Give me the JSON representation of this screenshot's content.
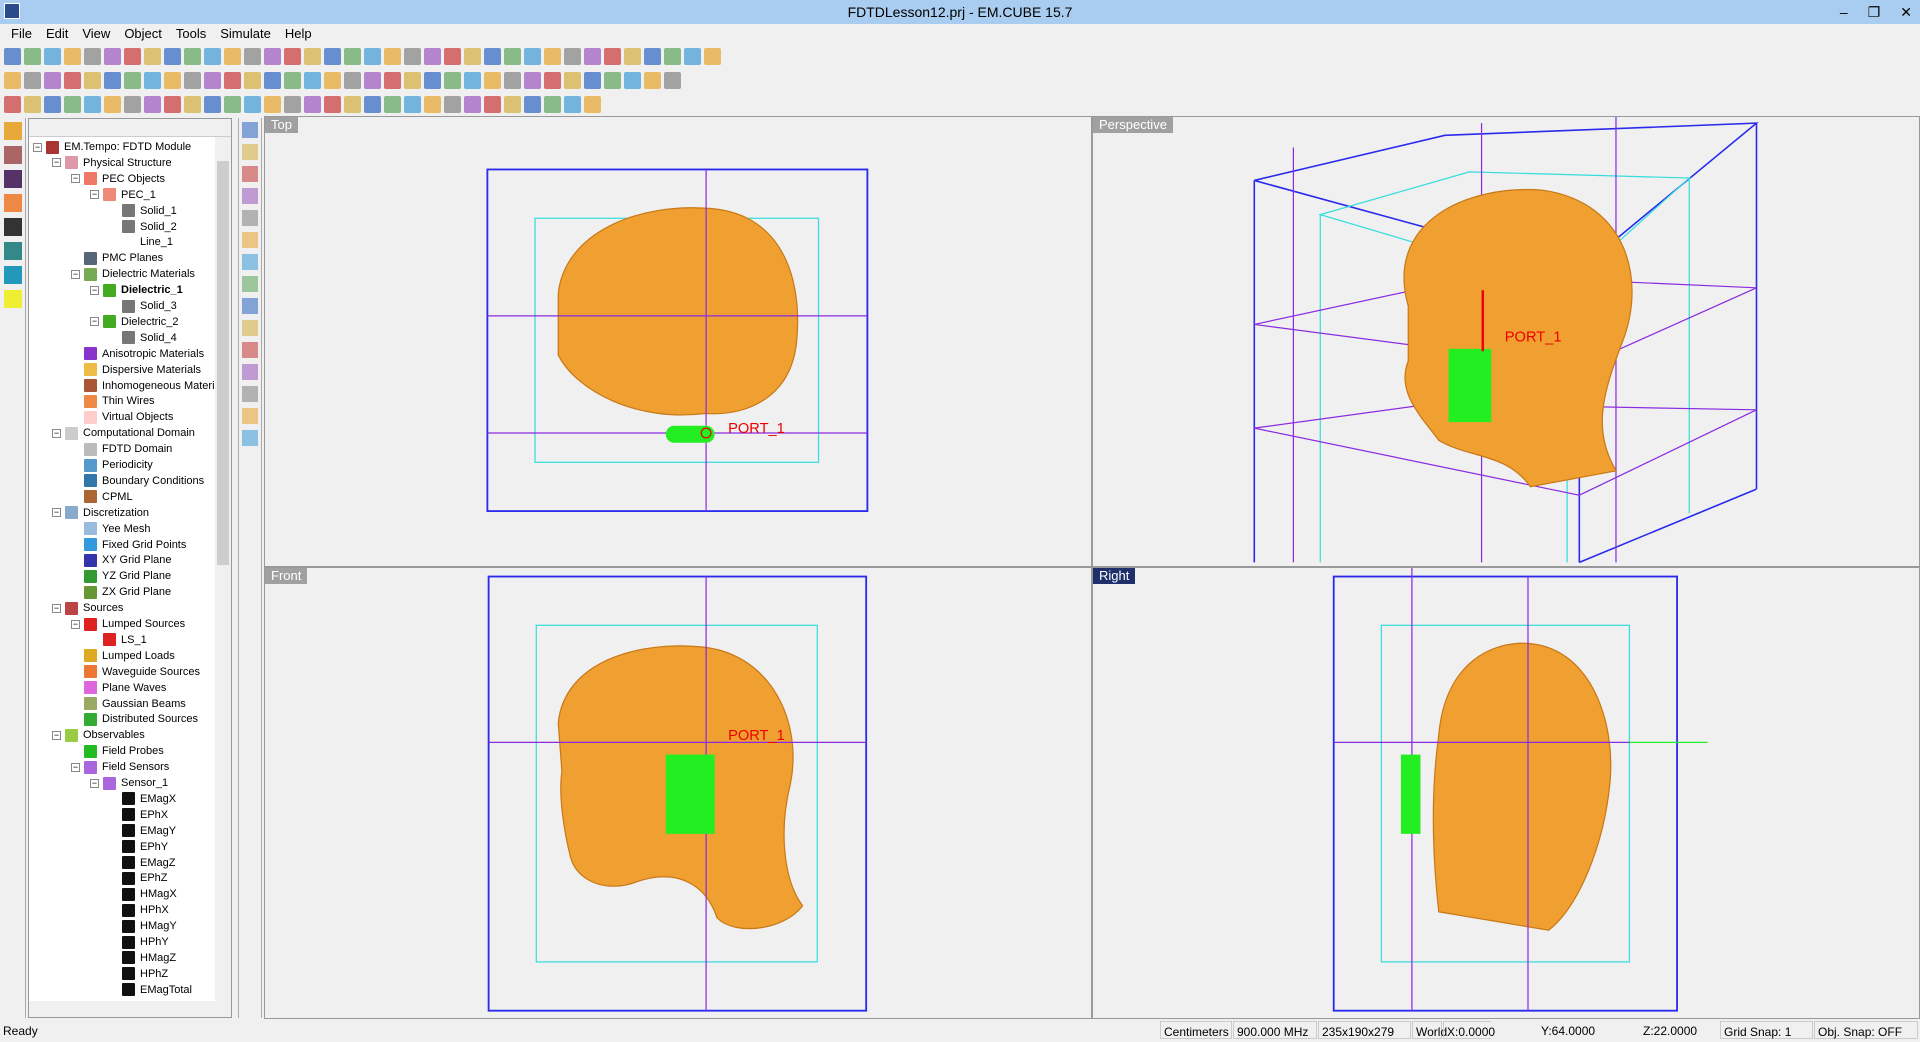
{
  "window": {
    "title": "FDTDLesson12.prj - EM.CUBE 15.7",
    "min": "–",
    "restore": "❐",
    "close": "✕"
  },
  "menu": [
    "File",
    "Edit",
    "View",
    "Object",
    "Tools",
    "Simulate",
    "Help"
  ],
  "toolbar_rows": [
    36,
    34,
    30
  ],
  "tree": {
    "items": [
      {
        "l": 0,
        "e": "−",
        "c": "#a33",
        "t": "EM.Tempo: FDTD Module"
      },
      {
        "l": 1,
        "e": "−",
        "c": "#d9a",
        "t": "Physical Structure"
      },
      {
        "l": 2,
        "e": "−",
        "c": "#e76",
        "t": "PEC Objects"
      },
      {
        "l": 3,
        "e": "−",
        "c": "#e87",
        "t": "PEC_1"
      },
      {
        "l": 4,
        "e": "",
        "c": "#777",
        "t": "Solid_1"
      },
      {
        "l": 4,
        "e": "",
        "c": "#777",
        "t": "Solid_2"
      },
      {
        "l": 4,
        "e": "",
        "c": "#fff",
        "t": "Line_1"
      },
      {
        "l": 2,
        "e": "",
        "c": "#567",
        "t": "PMC Planes"
      },
      {
        "l": 2,
        "e": "−",
        "c": "#7a5",
        "t": "Dielectric Materials"
      },
      {
        "l": 3,
        "e": "−",
        "c": "#4a2",
        "t": "Dielectric_1",
        "b": true
      },
      {
        "l": 4,
        "e": "",
        "c": "#777",
        "t": "Solid_3"
      },
      {
        "l": 3,
        "e": "−",
        "c": "#4a2",
        "t": "Dielectric_2"
      },
      {
        "l": 4,
        "e": "",
        "c": "#777",
        "t": "Solid_4"
      },
      {
        "l": 2,
        "e": "",
        "c": "#83c",
        "t": "Anisotropic Materials"
      },
      {
        "l": 2,
        "e": "",
        "c": "#eb4",
        "t": "Dispersive Materials"
      },
      {
        "l": 2,
        "e": "",
        "c": "#a53",
        "t": "Inhomogeneous Materi"
      },
      {
        "l": 2,
        "e": "",
        "c": "#e84",
        "t": "Thin Wires"
      },
      {
        "l": 2,
        "e": "",
        "c": "#fcc",
        "t": "Virtual Objects"
      },
      {
        "l": 1,
        "e": "−",
        "c": "#ccc",
        "t": "Computational Domain"
      },
      {
        "l": 2,
        "e": "",
        "c": "#bbb",
        "t": "FDTD Domain"
      },
      {
        "l": 2,
        "e": "",
        "c": "#59c",
        "t": "Periodicity"
      },
      {
        "l": 2,
        "e": "",
        "c": "#37a",
        "t": "Boundary Conditions"
      },
      {
        "l": 2,
        "e": "",
        "c": "#a63",
        "t": "CPML"
      },
      {
        "l": 1,
        "e": "−",
        "c": "#8ac",
        "t": "Discretization"
      },
      {
        "l": 2,
        "e": "",
        "c": "#9bd",
        "t": "Yee Mesh"
      },
      {
        "l": 2,
        "e": "",
        "c": "#39d",
        "t": "Fixed Grid Points"
      },
      {
        "l": 2,
        "e": "",
        "c": "#33a",
        "t": "XY Grid Plane"
      },
      {
        "l": 2,
        "e": "",
        "c": "#393",
        "t": "YZ Grid Plane"
      },
      {
        "l": 2,
        "e": "",
        "c": "#693",
        "t": "ZX Grid Plane"
      },
      {
        "l": 1,
        "e": "−",
        "c": "#b44",
        "t": "Sources"
      },
      {
        "l": 2,
        "e": "−",
        "c": "#d22",
        "t": "Lumped Sources"
      },
      {
        "l": 3,
        "e": "",
        "c": "#d22",
        "t": "LS_1"
      },
      {
        "l": 2,
        "e": "",
        "c": "#da2",
        "t": "Lumped Loads"
      },
      {
        "l": 2,
        "e": "",
        "c": "#e73",
        "t": "Waveguide Sources"
      },
      {
        "l": 2,
        "e": "",
        "c": "#d6d",
        "t": "Plane Waves"
      },
      {
        "l": 2,
        "e": "",
        "c": "#9a6",
        "t": "Gaussian Beams"
      },
      {
        "l": 2,
        "e": "",
        "c": "#3a3",
        "t": "Distributed Sources"
      },
      {
        "l": 1,
        "e": "−",
        "c": "#9c4",
        "t": "Observables"
      },
      {
        "l": 2,
        "e": "",
        "c": "#2b2",
        "t": "Field Probes"
      },
      {
        "l": 2,
        "e": "−",
        "c": "#a6d",
        "t": "Field Sensors"
      },
      {
        "l": 3,
        "e": "−",
        "c": "#a6d",
        "t": "Sensor_1"
      },
      {
        "l": 4,
        "e": "",
        "c": "#111",
        "t": "EMagX"
      },
      {
        "l": 4,
        "e": "",
        "c": "#111",
        "t": "EPhX"
      },
      {
        "l": 4,
        "e": "",
        "c": "#111",
        "t": "EMagY"
      },
      {
        "l": 4,
        "e": "",
        "c": "#111",
        "t": "EPhY"
      },
      {
        "l": 4,
        "e": "",
        "c": "#111",
        "t": "EMagZ"
      },
      {
        "l": 4,
        "e": "",
        "c": "#111",
        "t": "EPhZ"
      },
      {
        "l": 4,
        "e": "",
        "c": "#111",
        "t": "HMagX"
      },
      {
        "l": 4,
        "e": "",
        "c": "#111",
        "t": "HPhX"
      },
      {
        "l": 4,
        "e": "",
        "c": "#111",
        "t": "HMagY"
      },
      {
        "l": 4,
        "e": "",
        "c": "#111",
        "t": "HPhY"
      },
      {
        "l": 4,
        "e": "",
        "c": "#111",
        "t": "HMagZ"
      },
      {
        "l": 4,
        "e": "",
        "c": "#111",
        "t": "HPhZ"
      },
      {
        "l": 4,
        "e": "",
        "c": "#111",
        "t": "EMagTotal"
      }
    ]
  },
  "viewports": {
    "top": "Top",
    "perspective": "Perspective",
    "front": "Front",
    "right": "Right",
    "port_label": "PORT_1"
  },
  "colors": {
    "head": "#f0a030",
    "port": "#22ee22",
    "domain": "#2a2aee",
    "grid": "#8a2be2",
    "cpml": "#33dddd"
  },
  "status": {
    "ready": "Ready",
    "units": "Centimeters",
    "freq": "900.000 MHz",
    "grid": "235x190x279",
    "frame": "World",
    "x": "X:0.0000",
    "y": "Y:64.0000",
    "z": "Z:22.0000",
    "grid_snap": "Grid Snap:  1",
    "obj_snap": "Obj. Snap: OFF"
  }
}
